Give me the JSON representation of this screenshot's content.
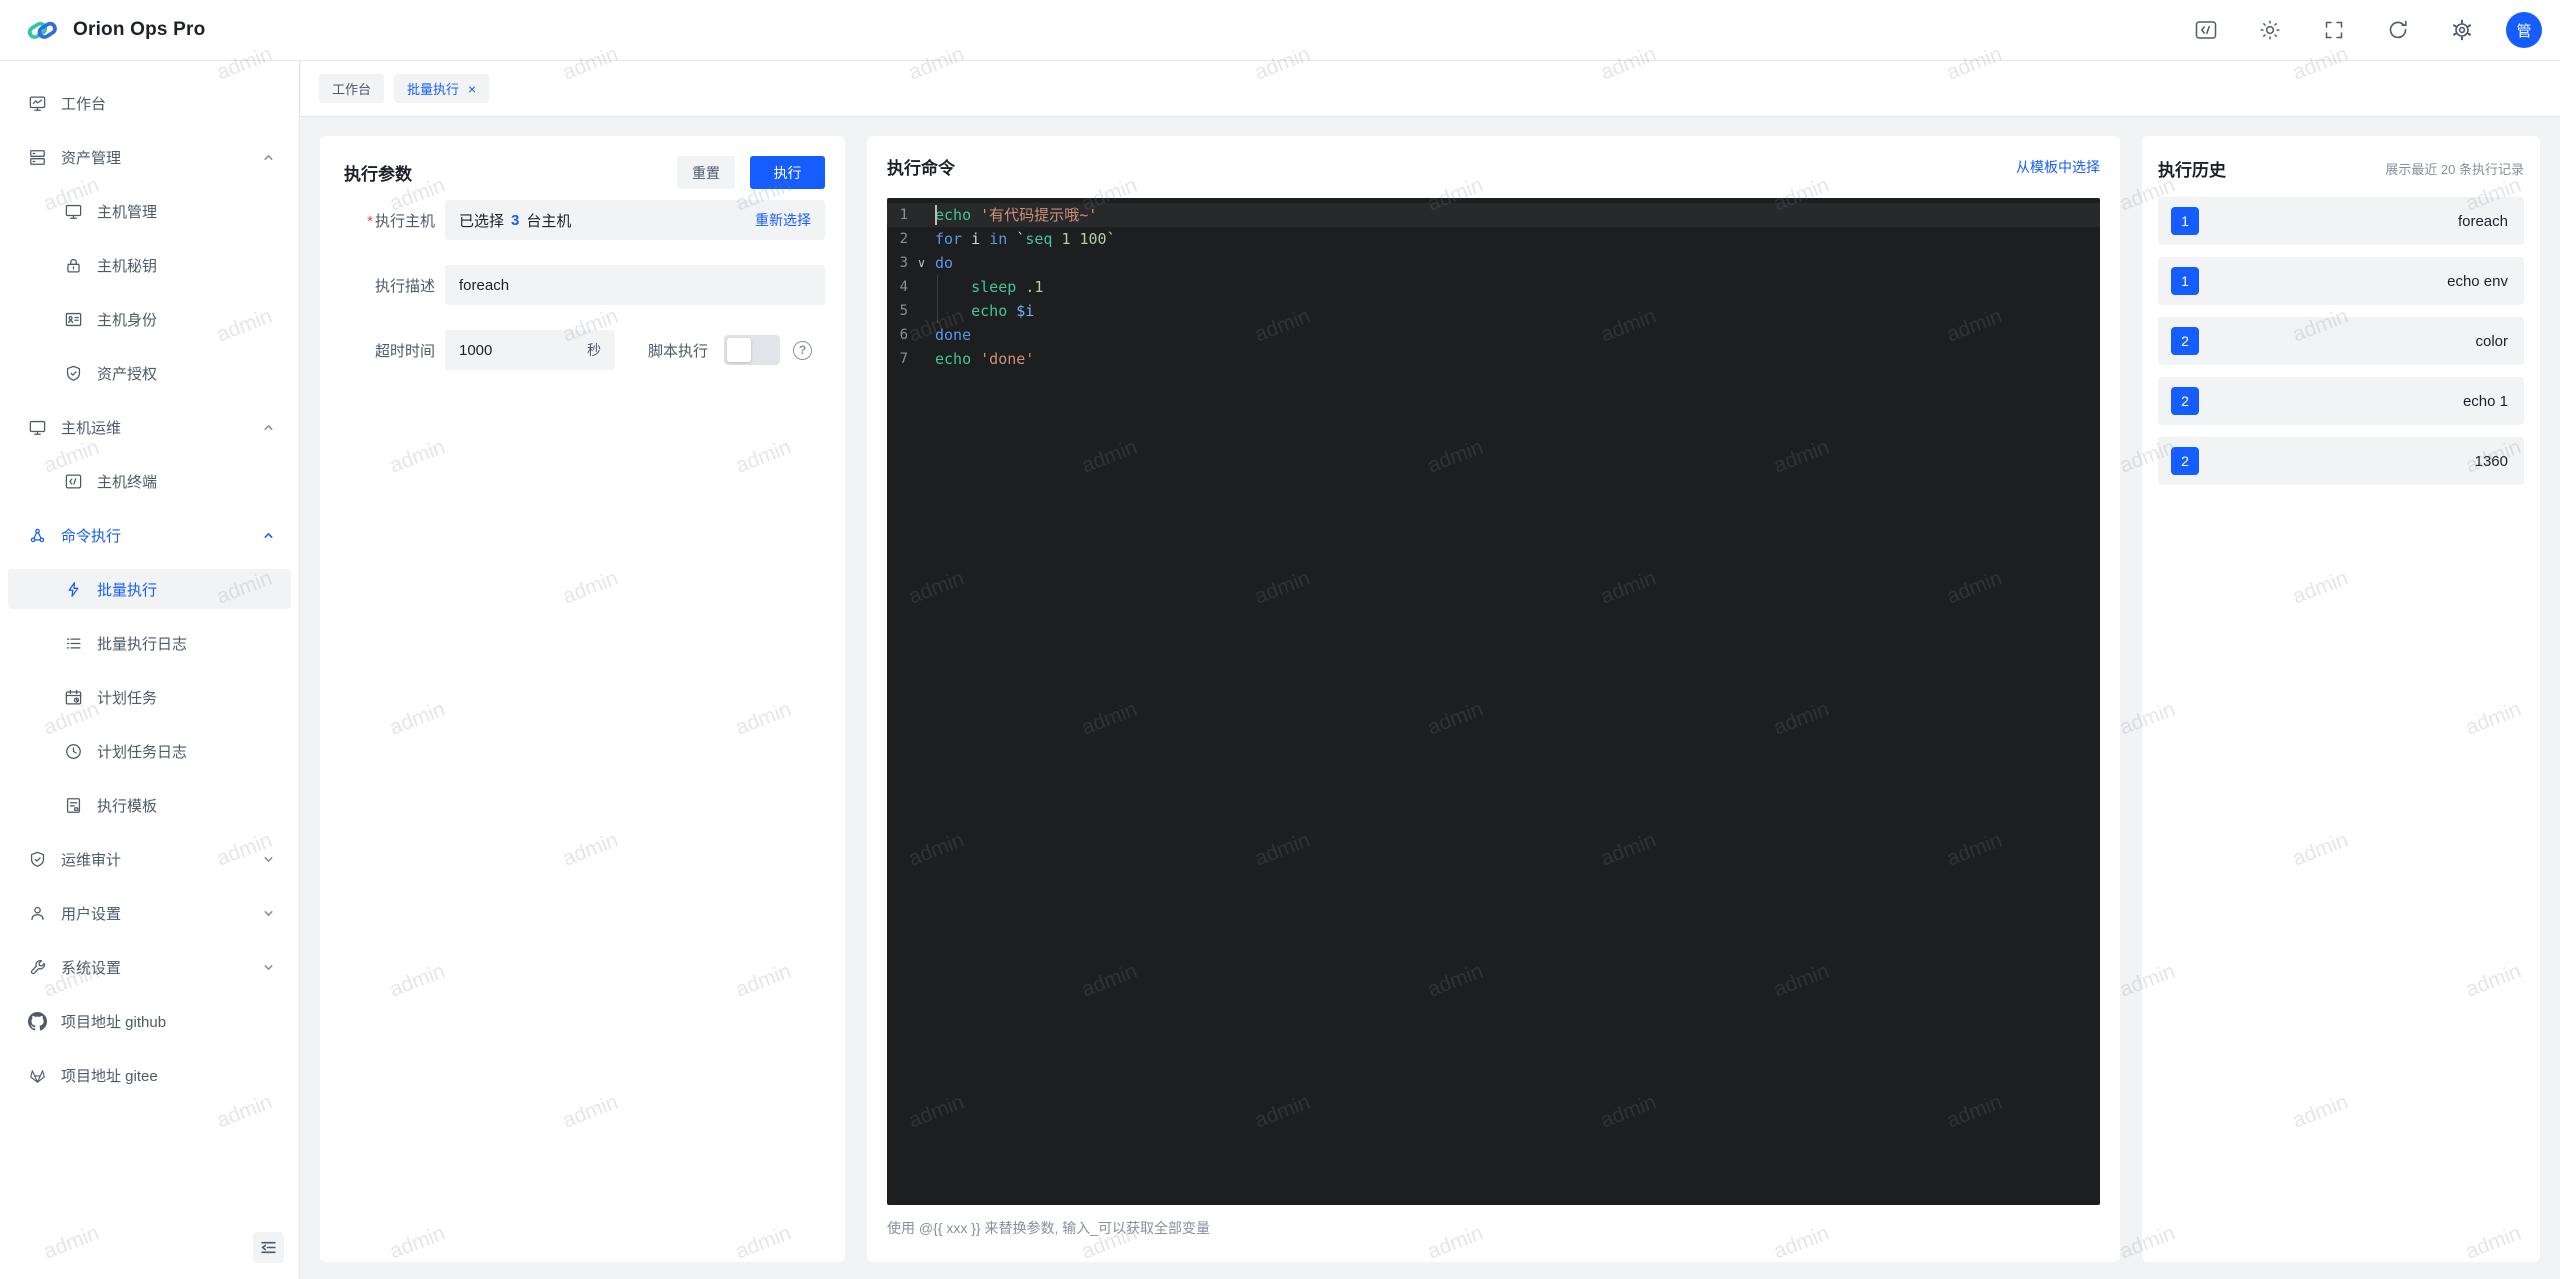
{
  "header": {
    "title": "Orion Ops Pro",
    "avatar_text": "管"
  },
  "tabs": [
    {
      "label": "工作台"
    },
    {
      "label": "批量执行",
      "close": "×"
    }
  ],
  "sidebar": {
    "items": [
      {
        "label": "工作台"
      },
      {
        "label": "资产管理"
      },
      {
        "label": "主机管理"
      },
      {
        "label": "主机秘钥"
      },
      {
        "label": "主机身份"
      },
      {
        "label": "资产授权"
      },
      {
        "label": "主机运维"
      },
      {
        "label": "主机终端"
      },
      {
        "label": "命令执行"
      },
      {
        "label": "批量执行"
      },
      {
        "label": "批量执行日志"
      },
      {
        "label": "计划任务"
      },
      {
        "label": "计划任务日志"
      },
      {
        "label": "执行模板"
      },
      {
        "label": "运维审计"
      },
      {
        "label": "用户设置"
      },
      {
        "label": "系统设置"
      },
      {
        "label": "项目地址 github"
      },
      {
        "label": "项目地址 gitee"
      }
    ]
  },
  "params": {
    "title": "执行参数",
    "reset_label": "重置",
    "execute_label": "执行",
    "required_mark": "*",
    "host_label": "执行主机",
    "host_selected_prefix": "已选择",
    "host_selected_count": "3",
    "host_selected_suffix": "台主机",
    "reselect_label": "重新选择",
    "desc_label": "执行描述",
    "desc_value": "foreach",
    "timeout_label": "超时时间",
    "timeout_value": "1000",
    "timeout_unit": "秒",
    "script_label": "脚本执行",
    "help_mark": "?"
  },
  "editor": {
    "title": "执行命令",
    "template_link": "从模板中选择",
    "hint": "使用 @{{ xxx }} 来替换参数, 输入_可以获取全部变量",
    "fold_mark": "∨",
    "lines": [
      {
        "no": "1",
        "current": true,
        "tokens": [
          {
            "t": "echo",
            "c": "cmd"
          },
          {
            "t": " ",
            "c": "pl"
          },
          {
            "t": "'有代码提示哦~'",
            "c": "str"
          }
        ]
      },
      {
        "no": "2",
        "tokens": [
          {
            "t": "for",
            "c": "kw"
          },
          {
            "t": " i ",
            "c": "pl"
          },
          {
            "t": "in",
            "c": "kw"
          },
          {
            "t": " `",
            "c": "pl"
          },
          {
            "t": "seq",
            "c": "cmd"
          },
          {
            "t": " ",
            "c": "pl"
          },
          {
            "t": "1 100",
            "c": "num"
          },
          {
            "t": "`",
            "c": "pl"
          }
        ]
      },
      {
        "no": "3",
        "fold": true,
        "tokens": [
          {
            "t": "do",
            "c": "kw"
          }
        ]
      },
      {
        "no": "4",
        "guide": true,
        "tokens": [
          {
            "t": "    ",
            "c": "pl"
          },
          {
            "t": "sleep",
            "c": "cmd"
          },
          {
            "t": " ",
            "c": "pl"
          },
          {
            "t": ".1",
            "c": "num"
          }
        ]
      },
      {
        "no": "5",
        "guide": true,
        "tokens": [
          {
            "t": "    ",
            "c": "pl"
          },
          {
            "t": "echo",
            "c": "cmd"
          },
          {
            "t": " ",
            "c": "pl"
          },
          {
            "t": "$i",
            "c": "var"
          }
        ]
      },
      {
        "no": "6",
        "tokens": [
          {
            "t": "done",
            "c": "kw"
          }
        ]
      },
      {
        "no": "7",
        "tokens": [
          {
            "t": "echo",
            "c": "cmd"
          },
          {
            "t": " ",
            "c": "pl"
          },
          {
            "t": "'done'",
            "c": "str"
          }
        ]
      }
    ]
  },
  "history": {
    "title": "执行历史",
    "meta": "展示最近 20 条执行记录",
    "items": [
      {
        "count": "1",
        "label": "foreach"
      },
      {
        "count": "1",
        "label": "echo env"
      },
      {
        "count": "2",
        "label": "color"
      },
      {
        "count": "2",
        "label": "echo 1"
      },
      {
        "count": "2",
        "label": "1360"
      }
    ]
  },
  "watermark": {
    "text": "admin"
  },
  "colors": {
    "primary": "#165dff",
    "danger": "#f53f3f",
    "editor_bg": "#1d1e1f"
  }
}
